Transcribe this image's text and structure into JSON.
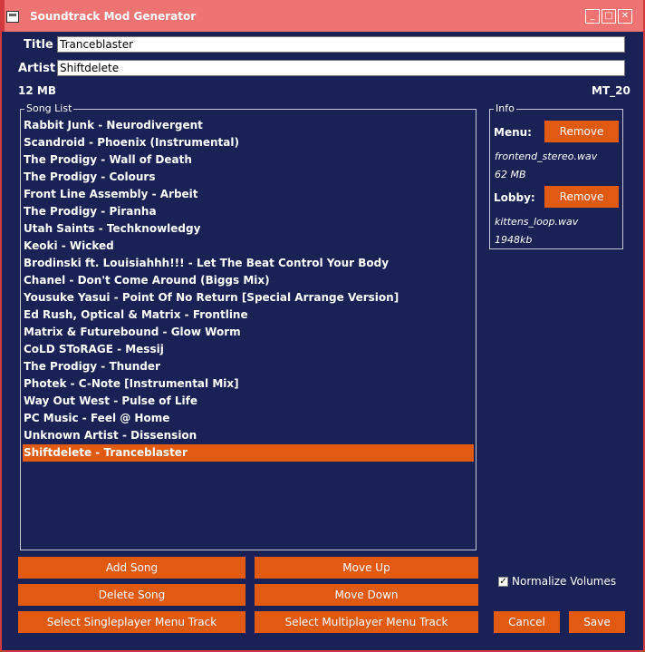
{
  "window": {
    "title": "Soundtrack Mod Generator",
    "buttons": [
      "_",
      "□",
      "✕"
    ]
  },
  "fields": {
    "title_label": "Title",
    "title_value": "Tranceblaster",
    "artist_label": "Artist",
    "artist_value": "Shiftdelete"
  },
  "status": {
    "size": "12 MB",
    "track_id": "MT_20"
  },
  "song_list": {
    "label": "Song List",
    "items": [
      "Rabbit Junk - Neurodivergent",
      "Scandroid - Phoenix (Instrumental)",
      "The Prodigy - Wall of Death",
      "The Prodigy - Colours",
      "Front Line Assembly - Arbeit",
      "The Prodigy - Piranha",
      "Utah Saints - Techknowledgy",
      "Keoki - Wicked",
      "Brodinski ft. Louisiahhh!!! - Let The Beat Control Your Body",
      "Chanel - Don't Come Around (Biggs Mix)",
      "Yousuke Yasui - Point Of No Return [Special Arrange Version]",
      "Ed Rush, Optical & Matrix - Frontline",
      "Matrix & Futurebound - Glow Worm",
      "CoLD SToRAGE - Messij",
      "The Prodigy - Thunder",
      "Photek - C-Note [Instrumental Mix]",
      "Way Out West - Pulse of Life",
      "PC Music - Feel @ Home",
      "Unknown Artist - Dissension",
      "Shiftdelete - Tranceblaster"
    ],
    "selected_index": 19
  },
  "info": {
    "label": "Info",
    "menu_label": "Menu:",
    "menu_remove": "Remove",
    "menu_file": "frontend_stereo.wav",
    "menu_size": "62 MB",
    "lobby_label": "Lobby:",
    "lobby_remove": "Remove",
    "lobby_file": "kittens_loop.wav",
    "lobby_size": "1948kb"
  },
  "buttons": {
    "add_song": "Add Song",
    "move_up": "Move Up",
    "delete_song": "Delete Song",
    "move_down": "Move Down",
    "select_sp": "Select Singleplayer Menu Track",
    "select_mp": "Select Multiplayer Menu Track",
    "cancel": "Cancel",
    "save": "Save"
  },
  "options": {
    "normalize_label": "Normalize Volumes",
    "normalize_checked": true
  },
  "colors": {
    "background": "#1a2154",
    "titlebar": "#ee7474",
    "accent": "#e05a12",
    "border": "#d33a3f"
  }
}
